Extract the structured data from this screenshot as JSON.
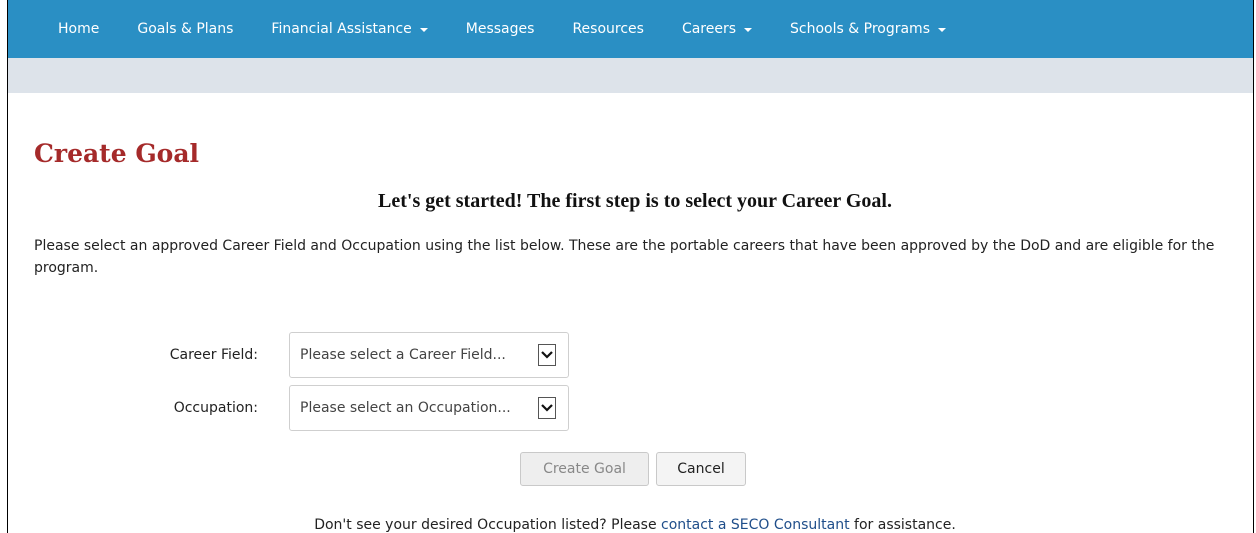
{
  "nav": {
    "items": [
      {
        "label": "Home",
        "dropdown": false
      },
      {
        "label": "Goals & Plans",
        "dropdown": false
      },
      {
        "label": "Financial Assistance",
        "dropdown": true
      },
      {
        "label": "Messages",
        "dropdown": false
      },
      {
        "label": "Resources",
        "dropdown": false
      },
      {
        "label": "Careers",
        "dropdown": true
      },
      {
        "label": "Schools & Programs",
        "dropdown": true
      }
    ]
  },
  "page": {
    "title": "Create Goal",
    "subheading": "Let's get started! The first step is to select your Career Goal.",
    "intro": "Please select an approved Career Field and Occupation using the list below. These are the portable careers that have been approved by the DoD and are eligible for the program."
  },
  "form": {
    "career_field_label": "Career Field:",
    "career_field_value": "Please select a Career Field...",
    "occupation_label": "Occupation:",
    "occupation_value": "Please select an Occupation..."
  },
  "buttons": {
    "create_label": "Create Goal",
    "cancel_label": "Cancel"
  },
  "help": {
    "prefix": "Don't see your desired Occupation listed? Please ",
    "link_text": "contact a SECO Consultant",
    "suffix": " for assistance."
  },
  "colors": {
    "navbar": "#2a8fc4",
    "title": "#a52a2a",
    "link": "#1f4e8a"
  }
}
